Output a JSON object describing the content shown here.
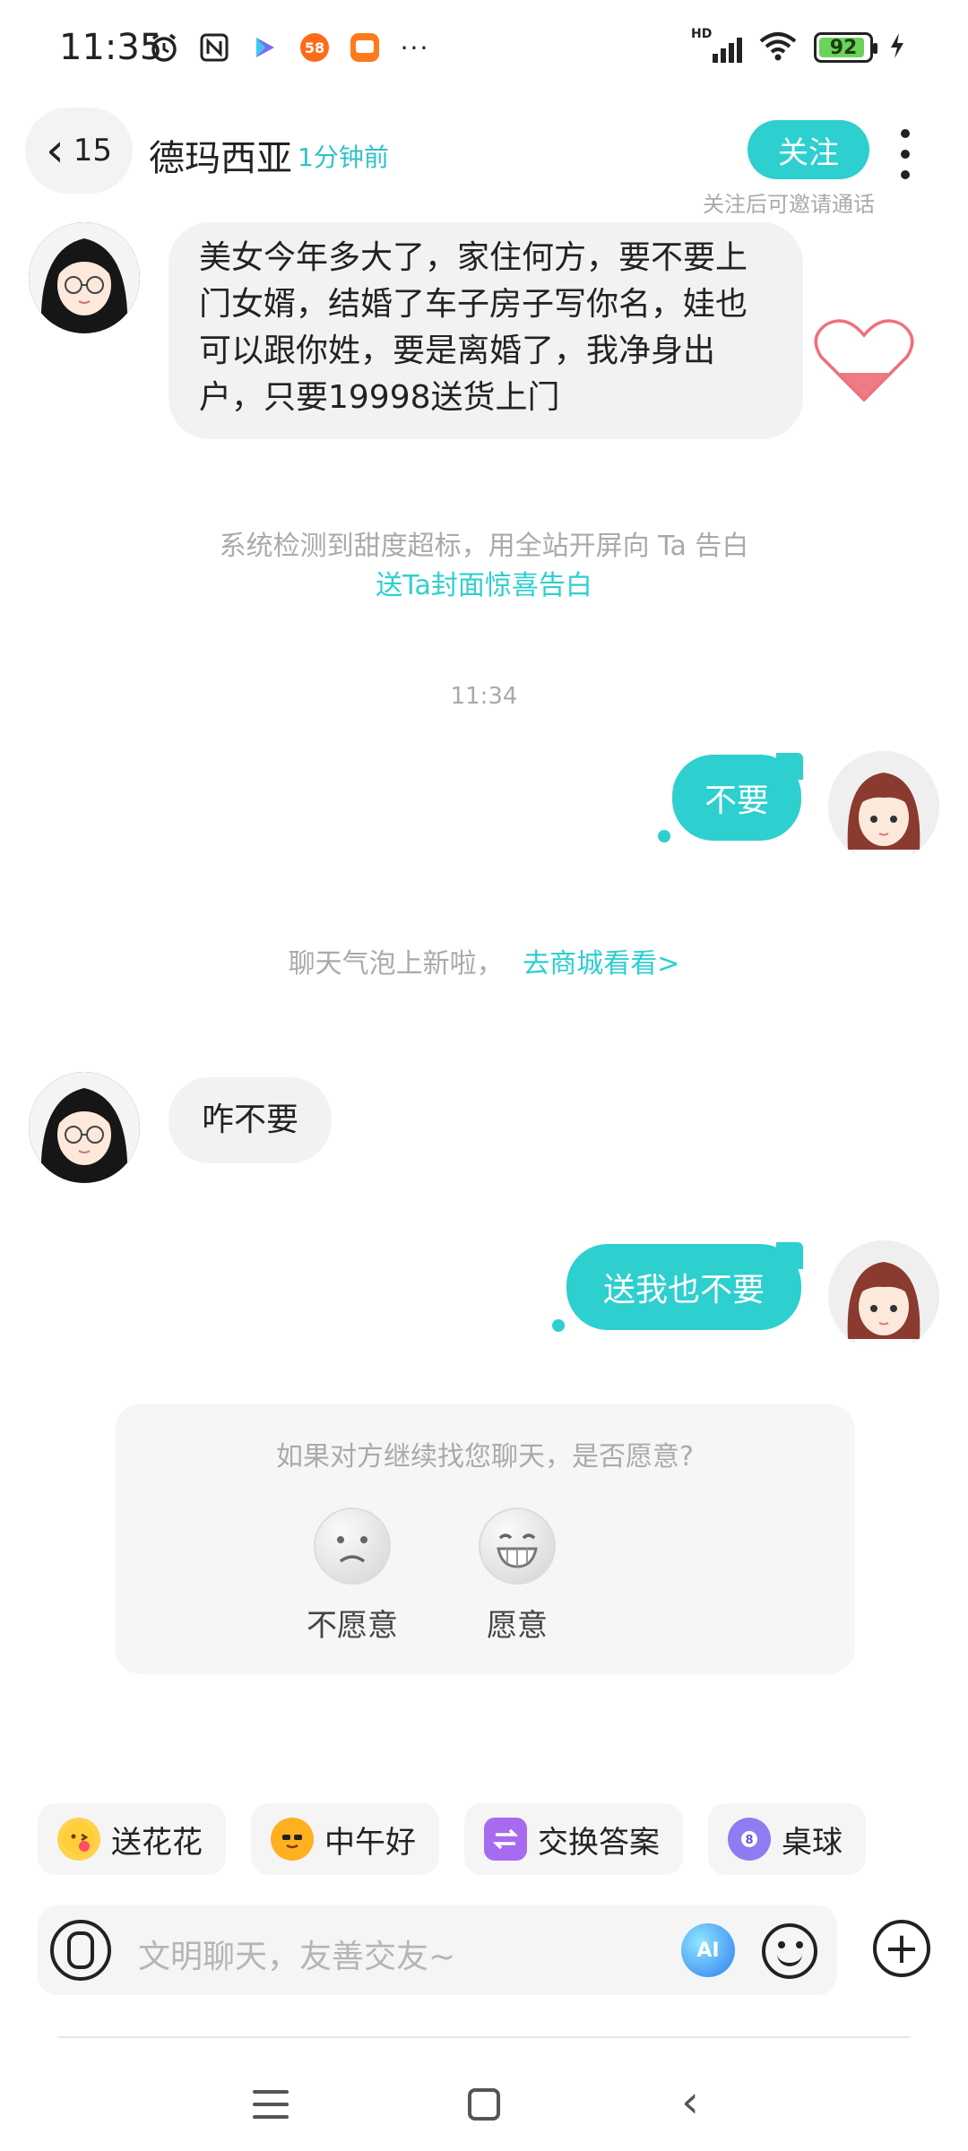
{
  "status_bar": {
    "time": "11:35",
    "network_label": "HD",
    "battery": "92"
  },
  "header": {
    "back_count": "15",
    "contact_name": "德玛西亚",
    "last_seen": "1分钟前",
    "follow_label": "关注",
    "follow_tip": "关注后可邀请通话"
  },
  "messages": {
    "m1": "美女今年多大了，家住何方，要不要上门女婿，结婚了车子房子写你名，娃也可以跟你姓，要是离婚了，我净身出户，只要19998送货上门",
    "sys1_text": "系统检测到甜度超标，用全站开屏向 Ta 告白",
    "sys1_link": "送Ta封面惊喜告白",
    "timestamp": "11:34",
    "m2": "不要",
    "sys2_text": "聊天气泡上新啦，",
    "sys2_link": "去商城看看>",
    "m3": "咋不要",
    "m4": "送我也不要"
  },
  "prompt_card": {
    "question": "如果对方继续找您聊天，是否愿意?",
    "decline_label": "不愿意",
    "accept_label": "愿意"
  },
  "quick_replies": [
    {
      "label": "送花花",
      "icon": "flower-kiss-icon",
      "color": "#ffd24a"
    },
    {
      "label": "中午好",
      "icon": "sun-sunglasses-icon",
      "color": "#ffb020"
    },
    {
      "label": "交换答案",
      "icon": "exchange-icon",
      "color": "#a76bf0"
    },
    {
      "label": "桌球",
      "icon": "billiard-ball-icon",
      "color": "#8f7cf0"
    }
  ],
  "input": {
    "placeholder": "文明聊天，友善交友~",
    "ai_label": "AI"
  },
  "colors": {
    "accent": "#2ecfcf",
    "bubble_left": "#f2f2f2",
    "muted_text": "#aaaaaa"
  }
}
